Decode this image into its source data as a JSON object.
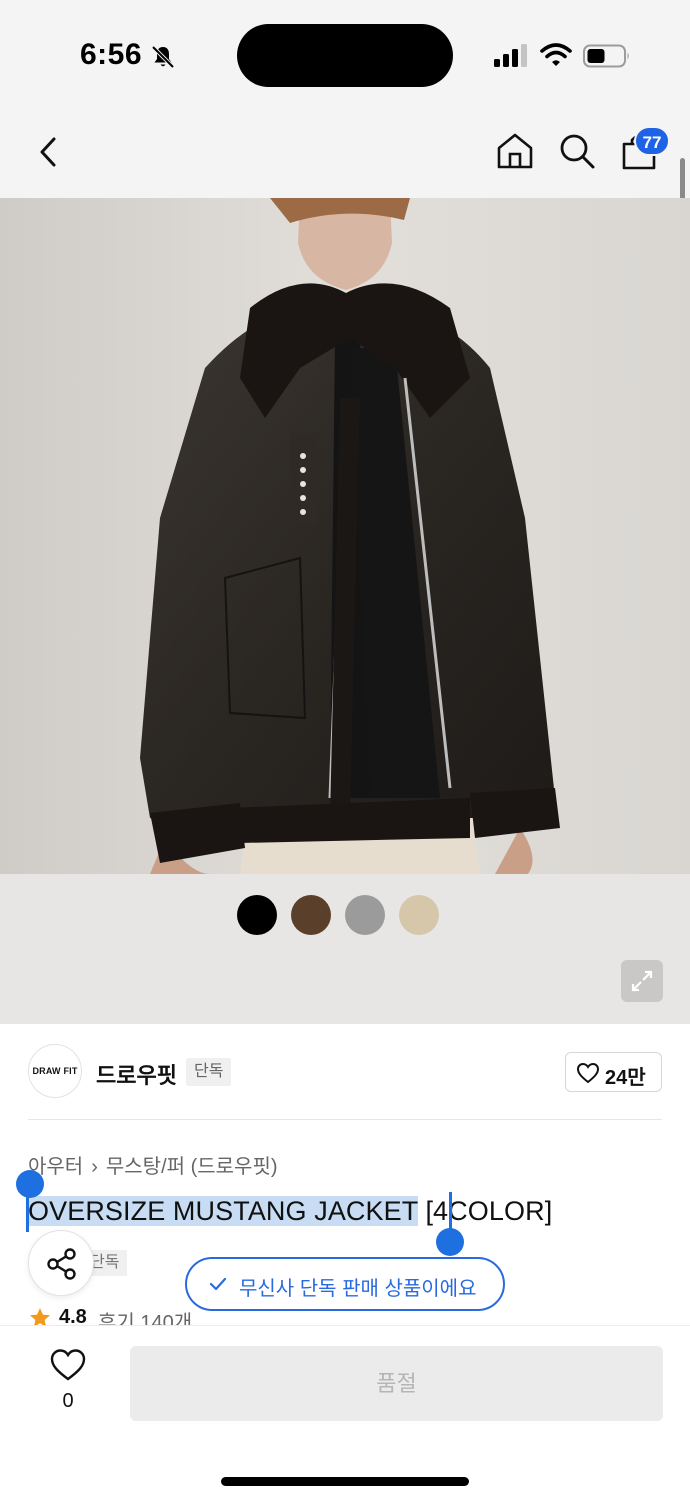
{
  "status_bar": {
    "time": "6:56",
    "icons": [
      "bell-off-icon",
      "signal-icon",
      "wifi-icon",
      "battery-icon"
    ]
  },
  "nav": {
    "icons": [
      "back-icon",
      "home-icon",
      "search-icon",
      "shopping-bag-icon"
    ],
    "cart_count": "77"
  },
  "product_image": {
    "description_icon": "product-photo"
  },
  "color_options": [
    {
      "color": "#000000"
    },
    {
      "color": "#5a3f2b"
    },
    {
      "color": "#9b9b9b"
    },
    {
      "color": "#d6c7ab"
    }
  ],
  "brand": {
    "logo_text": "DRAW FIT",
    "name": "드로우핏",
    "exclusive_tag": "단독",
    "like_count": "24만"
  },
  "product": {
    "breadcrumb": [
      "아우터",
      "무스탕/퍼 (드로우핏)"
    ],
    "title_selected": "OVERSIZE MUSTANG JACKET",
    "title_rest": " [4COLOR]",
    "exclusive_tag": "단독",
    "exclusive_toast": "무신사 단독 판매 상품이에요",
    "rating": "4.8",
    "review_label": "후기 140개"
  },
  "bottom_bar": {
    "like_count": "0",
    "soldout_label": "품절"
  },
  "colors": {
    "accent": "#1e63e6",
    "selection": "#c8dcf4",
    "star": "#f29a1c"
  }
}
